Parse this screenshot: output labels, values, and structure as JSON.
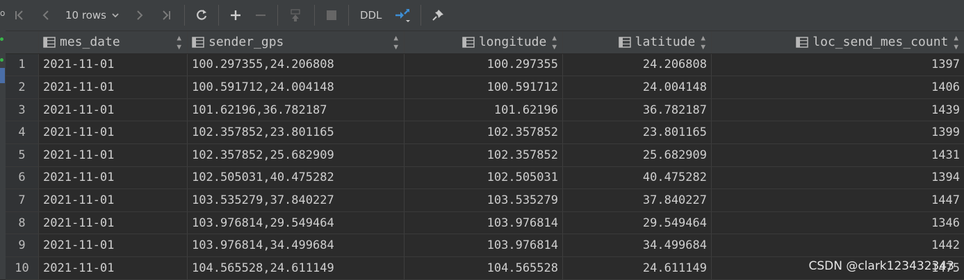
{
  "gutter": {
    "letter": "o"
  },
  "toolbar": {
    "rows_label": "10 rows",
    "ddl_label": "DDL"
  },
  "table": {
    "columns": [
      "mes_date",
      "sender_gps",
      "longitude",
      "latitude",
      "loc_send_mes_count"
    ],
    "rows": [
      [
        "1",
        "2021-11-01",
        "100.297355,24.206808",
        "100.297355",
        "24.206808",
        "1397"
      ],
      [
        "2",
        "2021-11-01",
        "100.591712,24.004148",
        "100.591712",
        "24.004148",
        "1406"
      ],
      [
        "3",
        "2021-11-01",
        "101.62196,36.782187",
        "101.62196",
        "36.782187",
        "1439"
      ],
      [
        "4",
        "2021-11-01",
        "102.357852,23.801165",
        "102.357852",
        "23.801165",
        "1399"
      ],
      [
        "5",
        "2021-11-01",
        "102.357852,25.682909",
        "102.357852",
        "25.682909",
        "1431"
      ],
      [
        "6",
        "2021-11-01",
        "102.505031,40.475282",
        "102.505031",
        "40.475282",
        "1394"
      ],
      [
        "7",
        "2021-11-01",
        "103.535279,37.840227",
        "103.535279",
        "37.840227",
        "1447"
      ],
      [
        "8",
        "2021-11-01",
        "103.976814,29.549464",
        "103.976814",
        "29.549464",
        "1346"
      ],
      [
        "9",
        "2021-11-01",
        "103.976814,34.499684",
        "103.976814",
        "34.499684",
        "1442"
      ],
      [
        "10",
        "2021-11-01",
        "104.565528,24.611149",
        "104.565528",
        "24.611149",
        "1475"
      ]
    ]
  },
  "watermark": "CSDN @clark123432343"
}
